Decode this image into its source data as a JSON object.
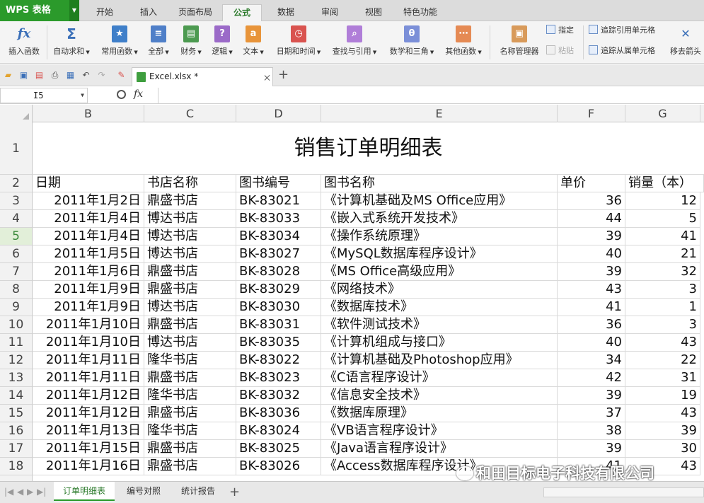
{
  "app": {
    "name": "WPS 表格"
  },
  "ribbon_tabs": [
    "开始",
    "插入",
    "页面布局",
    "公式",
    "数据",
    "审阅",
    "视图",
    "特色功能"
  ],
  "active_ribbon_tab": "公式",
  "ribbon": {
    "insert_function": "插入函数",
    "autosum": "自动求和",
    "common": "常用函数",
    "all": "全部",
    "finance": "财务",
    "logic": "逻辑",
    "text": "文本",
    "datetime": "日期和时间",
    "lookup": "查找与引用",
    "math": "数学和三角",
    "other": "其他函数",
    "name_manager": "名称管理器",
    "specify": "指定",
    "paste": "粘贴",
    "trace_precedents": "追踪引用单元格",
    "trace_dependents": "追踪从属单元格",
    "remove_arrows": "移去箭头"
  },
  "doc_tab": {
    "name": "Excel.xlsx *"
  },
  "formula_bar": {
    "cell_ref": "I5",
    "fx": "fx"
  },
  "columns": [
    "B",
    "C",
    "D",
    "E",
    "F",
    "G"
  ],
  "sheet": {
    "title": "销售订单明细表",
    "headers": [
      "日期",
      "书店名称",
      "图书编号",
      "图书名称",
      "单价",
      "销量（本）"
    ],
    "rows": [
      {
        "n": "3",
        "date": "2011年1月2日",
        "store": "鼎盛书店",
        "id": "BK-83021",
        "name": "《计算机基础及MS Office应用》",
        "price": "36",
        "qty": "12"
      },
      {
        "n": "4",
        "date": "2011年1月4日",
        "store": "博达书店",
        "id": "BK-83033",
        "name": "《嵌入式系统开发技术》",
        "price": "44",
        "qty": "5"
      },
      {
        "n": "5",
        "date": "2011年1月4日",
        "store": "博达书店",
        "id": "BK-83034",
        "name": "《操作系统原理》",
        "price": "39",
        "qty": "41"
      },
      {
        "n": "6",
        "date": "2011年1月5日",
        "store": "博达书店",
        "id": "BK-83027",
        "name": "《MySQL数据库程序设计》",
        "price": "40",
        "qty": "21"
      },
      {
        "n": "7",
        "date": "2011年1月6日",
        "store": "鼎盛书店",
        "id": "BK-83028",
        "name": "《MS Office高级应用》",
        "price": "39",
        "qty": "32"
      },
      {
        "n": "8",
        "date": "2011年1月9日",
        "store": "鼎盛书店",
        "id": "BK-83029",
        "name": "《网络技术》",
        "price": "43",
        "qty": "3"
      },
      {
        "n": "9",
        "date": "2011年1月9日",
        "store": "博达书店",
        "id": "BK-83030",
        "name": "《数据库技术》",
        "price": "41",
        "qty": "1"
      },
      {
        "n": "10",
        "date": "2011年1月10日",
        "store": "鼎盛书店",
        "id": "BK-83031",
        "name": "《软件测试技术》",
        "price": "36",
        "qty": "3"
      },
      {
        "n": "11",
        "date": "2011年1月10日",
        "store": "博达书店",
        "id": "BK-83035",
        "name": "《计算机组成与接口》",
        "price": "40",
        "qty": "43"
      },
      {
        "n": "12",
        "date": "2011年1月11日",
        "store": "隆华书店",
        "id": "BK-83022",
        "name": "《计算机基础及Photoshop应用》",
        "price": "34",
        "qty": "22"
      },
      {
        "n": "13",
        "date": "2011年1月11日",
        "store": "鼎盛书店",
        "id": "BK-83023",
        "name": "《C语言程序设计》",
        "price": "42",
        "qty": "31"
      },
      {
        "n": "14",
        "date": "2011年1月12日",
        "store": "隆华书店",
        "id": "BK-83032",
        "name": "《信息安全技术》",
        "price": "39",
        "qty": "19"
      },
      {
        "n": "15",
        "date": "2011年1月12日",
        "store": "鼎盛书店",
        "id": "BK-83036",
        "name": "《数据库原理》",
        "price": "37",
        "qty": "43"
      },
      {
        "n": "16",
        "date": "2011年1月13日",
        "store": "隆华书店",
        "id": "BK-83024",
        "name": "《VB语言程序设计》",
        "price": "38",
        "qty": "39"
      },
      {
        "n": "17",
        "date": "2011年1月15日",
        "store": "鼎盛书店",
        "id": "BK-83025",
        "name": "《Java语言程序设计》",
        "price": "39",
        "qty": "30"
      },
      {
        "n": "18",
        "date": "2011年1月16日",
        "store": "鼎盛书店",
        "id": "BK-83026",
        "name": "《Access数据库程序设计》",
        "price": "41",
        "qty": "43"
      }
    ]
  },
  "sheet_tabs": [
    "订单明细表",
    "编号对照",
    "统计报告"
  ],
  "active_sheet_tab": "订单明细表",
  "watermark": "和田目标电子科技有限公司",
  "colors": {
    "accent": "#2b9a2b",
    "selected_row_header": "#e2efd9"
  }
}
